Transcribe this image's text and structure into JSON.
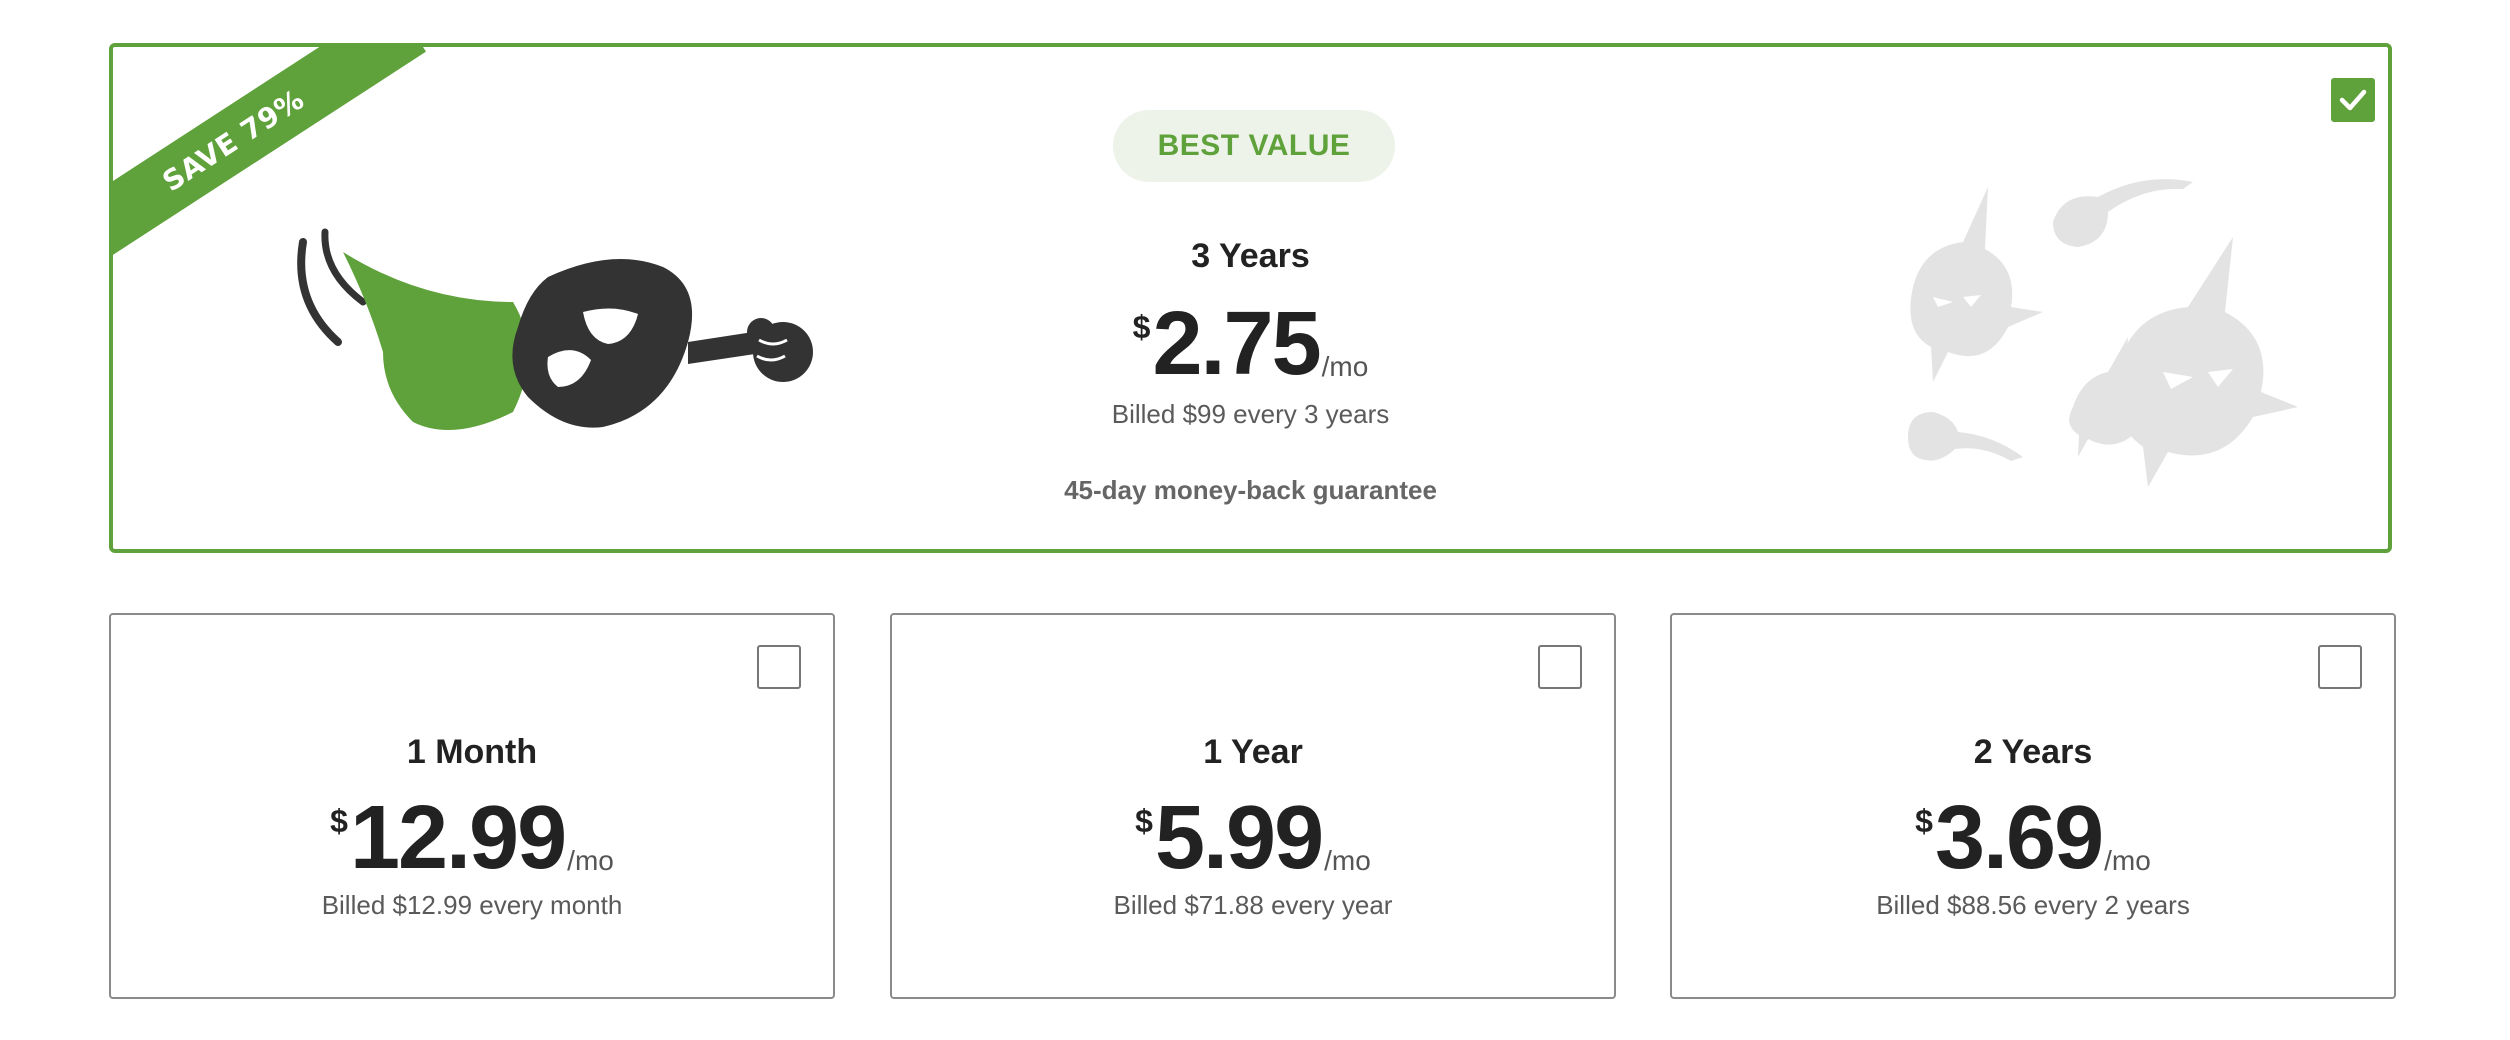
{
  "featured": {
    "ribbon": "SAVE 79%",
    "badge": "BEST VALUE",
    "title": "3 Years",
    "currency": "$",
    "price": "2.75",
    "per": "/mo",
    "billed": "Billed $99 every 3 years",
    "guarantee": "45-day money-back guarantee",
    "selected": true
  },
  "plans": [
    {
      "title": "1 Month",
      "currency": "$",
      "price": "12.99",
      "per": "/mo",
      "billed": "Billed $12.99 every month",
      "selected": false
    },
    {
      "title": "1 Year",
      "currency": "$",
      "price": "5.99",
      "per": "/mo",
      "billed": "Billed $71.88 every year",
      "selected": false
    },
    {
      "title": "2 Years",
      "currency": "$",
      "price": "3.69",
      "per": "/mo",
      "billed": "Billed $88.56 every 2 years",
      "selected": false
    }
  ],
  "colors": {
    "accent": "#5fa23b",
    "badge_bg": "#eef3ea",
    "text": "#222222",
    "muted": "#5a5a5a"
  },
  "icons": {
    "featured_checkbox": "checkmark-icon",
    "mascot": "vpn-hero-mascot-icon",
    "ghosts": "malware-ghosts-icon"
  }
}
